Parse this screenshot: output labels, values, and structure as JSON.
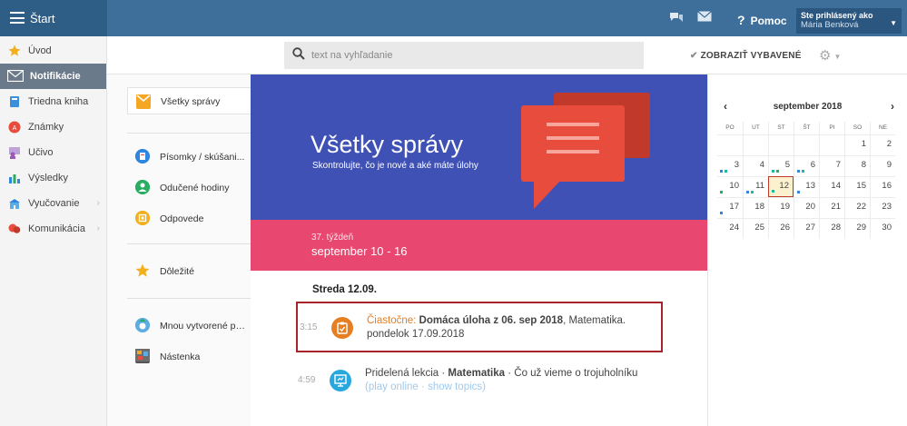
{
  "topbar": {
    "start_label": "Štart",
    "help_label": "Pomoc",
    "help_glyph": "?",
    "user_line1": "Ste prihlásený ako",
    "user_name": "Mária Benková"
  },
  "sidebar": {
    "items": [
      {
        "label": "Úvod",
        "icon": "star-icon",
        "color": "#f2b01e"
      },
      {
        "label": "Notifikácie",
        "icon": "envelope-icon",
        "color": "#ffffff"
      },
      {
        "label": "Triedna kniha",
        "icon": "book-icon",
        "color": "#3b8fd9"
      },
      {
        "label": "Známky",
        "icon": "grades-icon",
        "color": "#e74c3c"
      },
      {
        "label": "Učivo",
        "icon": "teacher-icon",
        "color": "#9b59b6"
      },
      {
        "label": "Výsledky",
        "icon": "bar-chart-icon",
        "color": "#2e86de"
      },
      {
        "label": "Vyučovanie",
        "icon": "school-icon",
        "color": "#2e86de"
      },
      {
        "label": "Komunikácia",
        "icon": "chat-icon",
        "color": "#e74c3c"
      }
    ]
  },
  "search": {
    "placeholder": "text na vyhľadanie",
    "show_selected": "ZOBRAZIŤ VYBAVENÉ"
  },
  "categories": {
    "all": "Všetky správy",
    "tests": "Písomky / skúšani...",
    "lessons": "Odučené hodiny",
    "answers": "Odpovede",
    "important": "Dôležité",
    "mine": "Mnou vytvorené prí...",
    "board": "Nástenka"
  },
  "hero": {
    "title": "Všetky správy",
    "subtitle": "Skontrolujte, čo je nové a aké máte úlohy",
    "week_label": "37. týždeň",
    "week_range": "september 10 - 16"
  },
  "messages": {
    "day_title": "Streda 12.09.",
    "items": [
      {
        "time": "3:15",
        "status": "Čiastočne:",
        "title": "Domáca úloha z 06. sep 2018",
        "rest": ", Matematika.",
        "line2": "pondelok 17.09.2018",
        "icon": "homework-icon",
        "icon_color": "#e67e22"
      },
      {
        "time": "4:59",
        "prefix": "Pridelená lekcia · ",
        "subject": "Matematika",
        "rest": " · Čo už vieme o trojuholníku",
        "link1": "(play online",
        "sep": " · ",
        "link2": "show topics)",
        "icon": "lesson-icon",
        "icon_color": "#29a8e0"
      }
    ]
  },
  "calendar": {
    "title": "september 2018",
    "prev": "‹",
    "next": "›",
    "dows": [
      "PO",
      "UT",
      "ST",
      "ŠT",
      "PI",
      "SO",
      "NE"
    ],
    "weeks": [
      [
        "",
        "",
        "",
        "",
        "",
        "1",
        "2"
      ],
      [
        "3",
        "4",
        "5",
        "6",
        "7",
        "8",
        "9"
      ],
      [
        "10",
        "11",
        "12",
        "13",
        "14",
        "15",
        "16"
      ],
      [
        "17",
        "18",
        "19",
        "20",
        "21",
        "22",
        "23"
      ],
      [
        "24",
        "25",
        "26",
        "27",
        "28",
        "29",
        "30"
      ]
    ],
    "today": "12",
    "colors": {
      "blue": "#2e86de",
      "green": "#27ae60",
      "teal": "#1abc9c"
    }
  }
}
